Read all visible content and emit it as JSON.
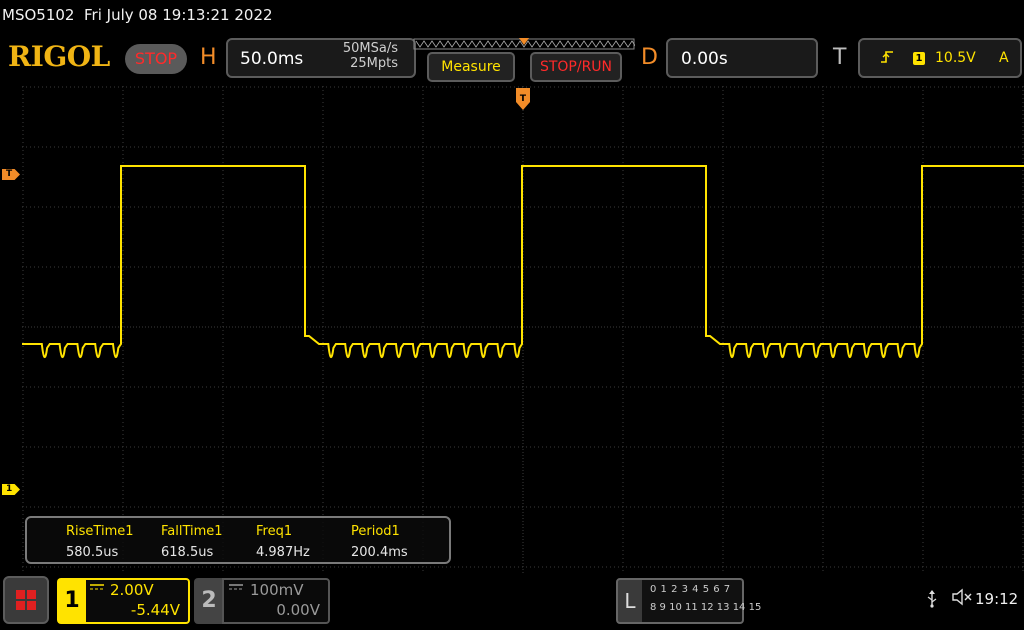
{
  "header": {
    "model": "MSO5102",
    "datetime": "Fri July 08 19:13:21 2022",
    "brand": "RIGOL",
    "run_state": "STOP"
  },
  "horizontal": {
    "letter": "H",
    "timebase": "50.0ms",
    "sample_rate": "50MSa/s",
    "memory_depth": "25Mpts"
  },
  "buttons": {
    "measure": "Measure",
    "stop_run": "STOP/RUN"
  },
  "delay": {
    "letter": "D",
    "value": "0.00s"
  },
  "trigger": {
    "letter": "T",
    "edge_icon": "rising-edge-icon",
    "source": "1",
    "level": "10.5V",
    "mode": "A",
    "level_marker": "T"
  },
  "measurements": [
    {
      "label": "RiseTime1",
      "value": "580.5us"
    },
    {
      "label": "FallTime1",
      "value": "618.5us"
    },
    {
      "label": "Freq1",
      "value": "4.987Hz"
    },
    {
      "label": "Period1",
      "value": "200.4ms"
    }
  ],
  "channel1": {
    "number": "1",
    "coupling_icon": "dc-coupling-icon",
    "scale": "2.00V",
    "offset": "-5.44V",
    "offset_marker": "1",
    "color": "#ffe300"
  },
  "channel2": {
    "number": "2",
    "coupling_icon": "dc-coupling-icon",
    "scale": "100mV",
    "offset": "0.00V"
  },
  "logic_analyzer": {
    "letter": "L",
    "row1": "0 1 2 3   4 5 6 7",
    "row2": "8 9 10 11 12 13 14 15"
  },
  "status": {
    "usb_icon": "usb-icon",
    "speaker_icon": "speaker-muted-icon",
    "time": "19:12"
  },
  "waveform": {
    "period_ms": 200.4,
    "duty_high_fraction": 0.455,
    "ripple_pulses_per_low": 11,
    "colors": {
      "trace": "#ffe300",
      "grid": "#3c3c3c",
      "trigger": "#f28c28"
    }
  }
}
